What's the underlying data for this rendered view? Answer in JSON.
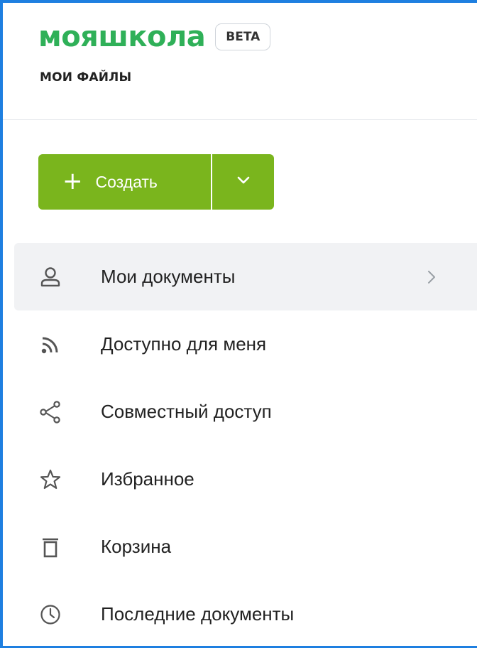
{
  "header": {
    "brand": "мояшкола",
    "badge": "BETA",
    "subtitle": "МОИ ФАЙЛЫ"
  },
  "create": {
    "label": "Создать",
    "plus_icon": "plus-icon",
    "dropdown_icon": "chevron-down-icon"
  },
  "nav": {
    "items": [
      {
        "label": "Мои документы",
        "icon": "person-icon",
        "active": true
      },
      {
        "label": "Доступно для меня",
        "icon": "rss-icon"
      },
      {
        "label": "Совместный доступ",
        "icon": "share-icon"
      },
      {
        "label": "Избранное",
        "icon": "star-icon"
      },
      {
        "label": "Корзина",
        "icon": "trash-icon"
      },
      {
        "label": "Последние документы",
        "icon": "clock-icon"
      }
    ]
  },
  "colors": {
    "brand": "#2fb058",
    "accent": "#7ab51d",
    "frame": "#1e7fe0"
  }
}
